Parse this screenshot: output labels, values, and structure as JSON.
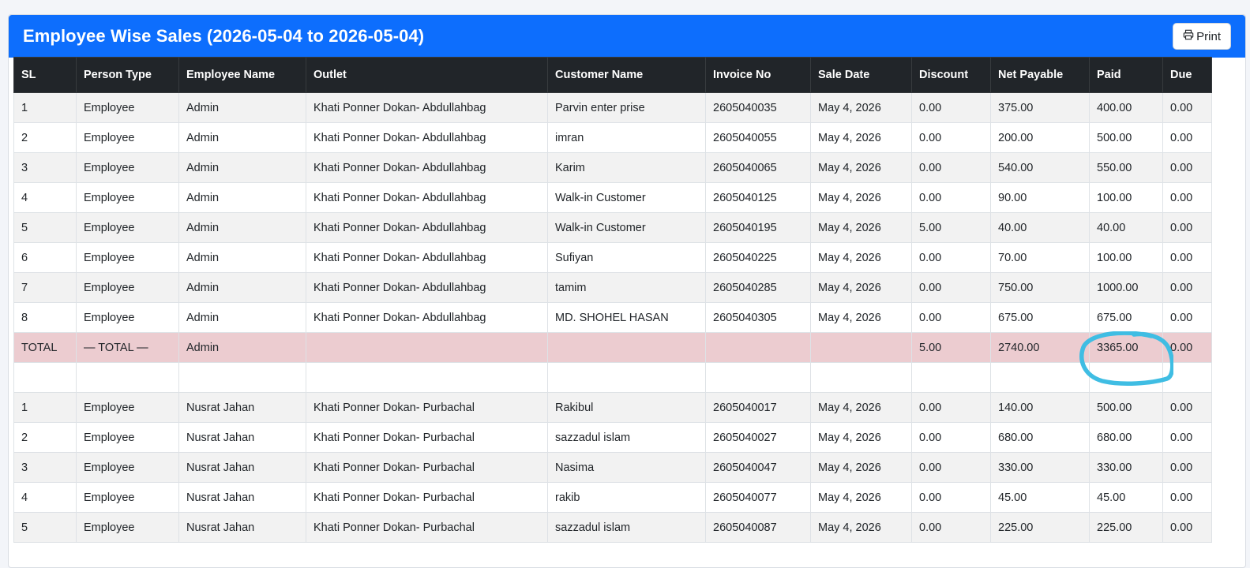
{
  "header": {
    "title": "Employee Wise Sales (2026-05-04 to 2026-05-04)",
    "print_label": "Print",
    "accent_color": "#0d6efd"
  },
  "table": {
    "columns": [
      "SL",
      "Person Type",
      "Employee Name",
      "Outlet",
      "Customer Name",
      "Invoice No",
      "Sale Date",
      "Discount",
      "Net Payable",
      "Paid",
      "Due"
    ],
    "rows": [
      {
        "type": "data",
        "cells": [
          "1",
          "Employee",
          "Admin",
          "Khati Ponner Dokan- Abdullahbag",
          "Parvin enter prise",
          "2605040035",
          "May 4, 2026",
          "0.00",
          "375.00",
          "400.00",
          "0.00"
        ]
      },
      {
        "type": "data",
        "cells": [
          "2",
          "Employee",
          "Admin",
          "Khati Ponner Dokan- Abdullahbag",
          "imran",
          "2605040055",
          "May 4, 2026",
          "0.00",
          "200.00",
          "500.00",
          "0.00"
        ]
      },
      {
        "type": "data",
        "cells": [
          "3",
          "Employee",
          "Admin",
          "Khati Ponner Dokan- Abdullahbag",
          "Karim",
          "2605040065",
          "May 4, 2026",
          "0.00",
          "540.00",
          "550.00",
          "0.00"
        ]
      },
      {
        "type": "data",
        "cells": [
          "4",
          "Employee",
          "Admin",
          "Khati Ponner Dokan- Abdullahbag",
          "Walk-in Customer",
          "2605040125",
          "May 4, 2026",
          "0.00",
          "90.00",
          "100.00",
          "0.00"
        ]
      },
      {
        "type": "data",
        "cells": [
          "5",
          "Employee",
          "Admin",
          "Khati Ponner Dokan- Abdullahbag",
          "Walk-in Customer",
          "2605040195",
          "May 4, 2026",
          "5.00",
          "40.00",
          "40.00",
          "0.00"
        ]
      },
      {
        "type": "data",
        "cells": [
          "6",
          "Employee",
          "Admin",
          "Khati Ponner Dokan- Abdullahbag",
          "Sufiyan",
          "2605040225",
          "May 4, 2026",
          "0.00",
          "70.00",
          "100.00",
          "0.00"
        ]
      },
      {
        "type": "data",
        "cells": [
          "7",
          "Employee",
          "Admin",
          "Khati Ponner Dokan- Abdullahbag",
          "tamim",
          "2605040285",
          "May 4, 2026",
          "0.00",
          "750.00",
          "1000.00",
          "0.00"
        ]
      },
      {
        "type": "data",
        "cells": [
          "8",
          "Employee",
          "Admin",
          "Khati Ponner Dokan- Abdullahbag",
          "MD. SHOHEL HASAN",
          "2605040305",
          "May 4, 2026",
          "0.00",
          "675.00",
          "675.00",
          "0.00"
        ]
      },
      {
        "type": "total",
        "cells": [
          "TOTAL",
          "— TOTAL —",
          "Admin",
          "",
          "",
          "",
          "",
          "5.00",
          "2740.00",
          "3365.00",
          "0.00"
        ]
      },
      {
        "type": "blank",
        "cells": [
          "",
          "",
          "",
          "",
          "",
          "",
          "",
          "",
          "",
          "",
          ""
        ]
      },
      {
        "type": "data",
        "cells": [
          "1",
          "Employee",
          "Nusrat Jahan",
          "Khati Ponner Dokan- Purbachal",
          "Rakibul",
          "2605040017",
          "May 4, 2026",
          "0.00",
          "140.00",
          "500.00",
          "0.00"
        ]
      },
      {
        "type": "data",
        "cells": [
          "2",
          "Employee",
          "Nusrat Jahan",
          "Khati Ponner Dokan- Purbachal",
          "sazzadul islam",
          "2605040027",
          "May 4, 2026",
          "0.00",
          "680.00",
          "680.00",
          "0.00"
        ]
      },
      {
        "type": "data",
        "cells": [
          "3",
          "Employee",
          "Nusrat Jahan",
          "Khati Ponner Dokan- Purbachal",
          "Nasima",
          "2605040047",
          "May 4, 2026",
          "0.00",
          "330.00",
          "330.00",
          "0.00"
        ]
      },
      {
        "type": "data",
        "cells": [
          "4",
          "Employee",
          "Nusrat Jahan",
          "Khati Ponner Dokan- Purbachal",
          "rakib",
          "2605040077",
          "May 4, 2026",
          "0.00",
          "45.00",
          "45.00",
          "0.00"
        ]
      },
      {
        "type": "data",
        "cells": [
          "5",
          "Employee",
          "Nusrat Jahan",
          "Khati Ponner Dokan- Purbachal",
          "sazzadul islam",
          "2605040087",
          "May 4, 2026",
          "0.00",
          "225.00",
          "225.00",
          "0.00"
        ]
      }
    ]
  },
  "annotation": {
    "shape": "hand-drawn circle",
    "color": "#3fbde3"
  }
}
